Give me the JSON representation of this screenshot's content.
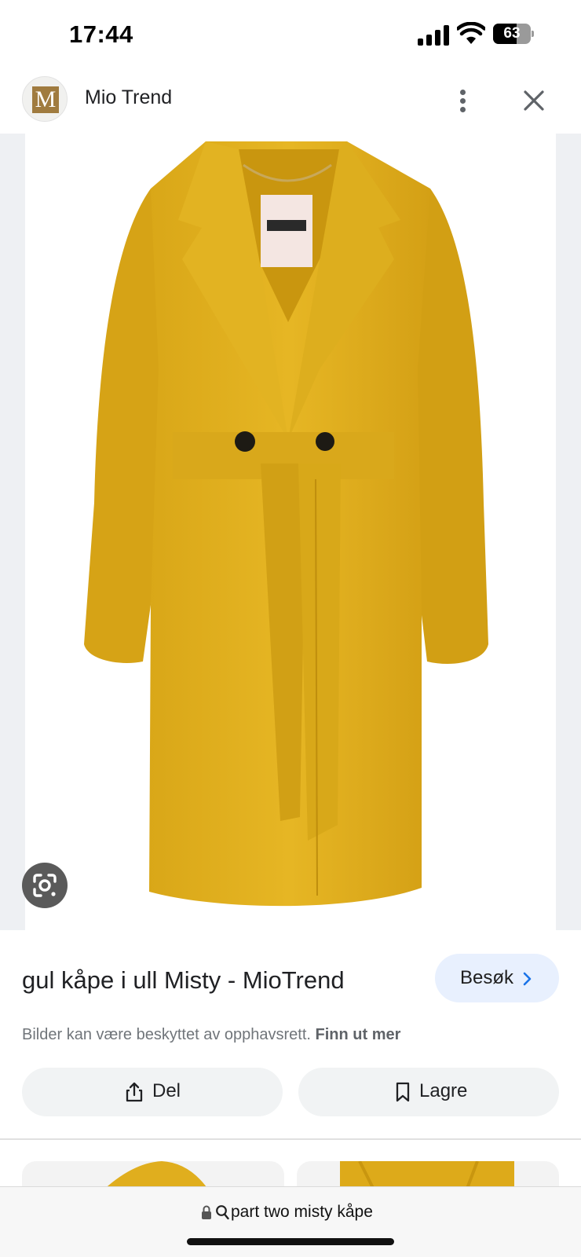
{
  "status_bar": {
    "time": "17:44",
    "battery": "63",
    "icons": [
      "signal-icon",
      "wifi-icon",
      "battery-icon"
    ]
  },
  "source": {
    "logo_letter": "M",
    "name": "Mio Trend",
    "icons": [
      "more-vert-icon",
      "close-icon"
    ]
  },
  "image": {
    "subject": "yellow wool coat",
    "accent_color": "#E3B21C",
    "lens_icon": "google-lens-icon"
  },
  "result": {
    "title": "gul kåpe i ull Misty - MioTrend",
    "visit_label": "Besøk",
    "copyright_text": "Bilder kan være beskyttet av opphavsrett.",
    "learn_more": "Finn ut mer"
  },
  "actions": {
    "share_label": "Del",
    "save_label": "Lagre"
  },
  "url_bar": {
    "query": "part two misty kåpe"
  },
  "colors": {
    "visit_button_bg": "#E8F0FE",
    "action_button_bg": "#F1F3F4",
    "link_blue": "#1A73E8"
  }
}
